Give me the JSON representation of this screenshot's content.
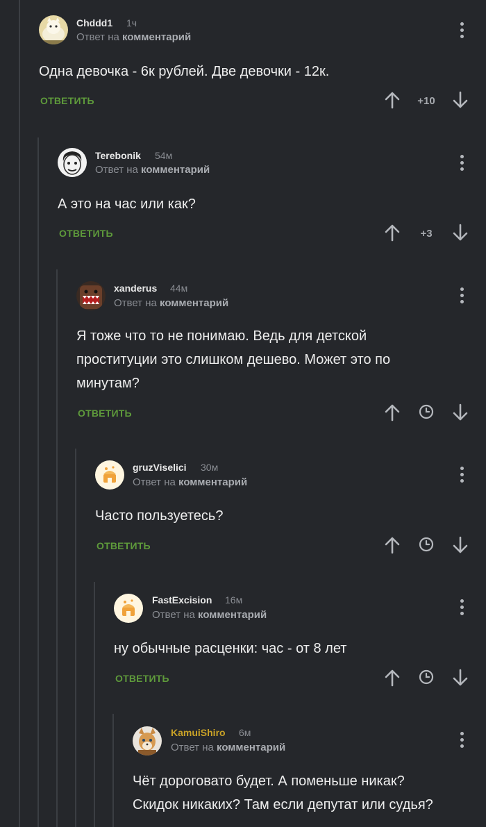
{
  "reply_to_prefix": "Ответ на",
  "reply_to_target": "комментарий",
  "reply_label": "ОТВЕТИТЬ",
  "colors": {
    "background": "#25272b",
    "thread_line": "#3b3e43",
    "reply_button": "#5e9a3b",
    "highlight_user": "#c9a227"
  },
  "comments": [
    {
      "username": "Chddd1",
      "time": "1ч",
      "text": "Одна девочка - 6к рублей. Две девочки - 12к.",
      "rating": "+10",
      "avatar_icon": "cat-avatar-icon"
    },
    {
      "username": "Terebonik",
      "time": "54м",
      "text": "А это на час или как?",
      "rating": "+3",
      "avatar_icon": "face-sketch-avatar-icon"
    },
    {
      "username": "xanderus",
      "time": "44м",
      "text_lines": [
        "Я тоже что то не понимаю. Ведь  для детской",
        "проституции это слишком дешево. Может это по",
        "минутам?"
      ],
      "rating": "",
      "avatar_icon": "domo-avatar-icon"
    },
    {
      "username": "gruzViselici",
      "time": "30м",
      "text": "Часто пользуетесь?",
      "rating": "",
      "avatar_icon": "default-avatar-icon"
    },
    {
      "username": "FastExcision",
      "time": "16м",
      "text": "ну обычные расценки: час - от 8 лет",
      "rating": "",
      "avatar_icon": "default-avatar-icon"
    },
    {
      "username": "KamuiShiro",
      "time": "6м",
      "text_lines": [
        "Чёт дороговато будет. А поменьше никак?",
        "Скидок никаких? Там если депутат или судья?"
      ],
      "avatar_icon": "fox-avatar-icon"
    }
  ]
}
